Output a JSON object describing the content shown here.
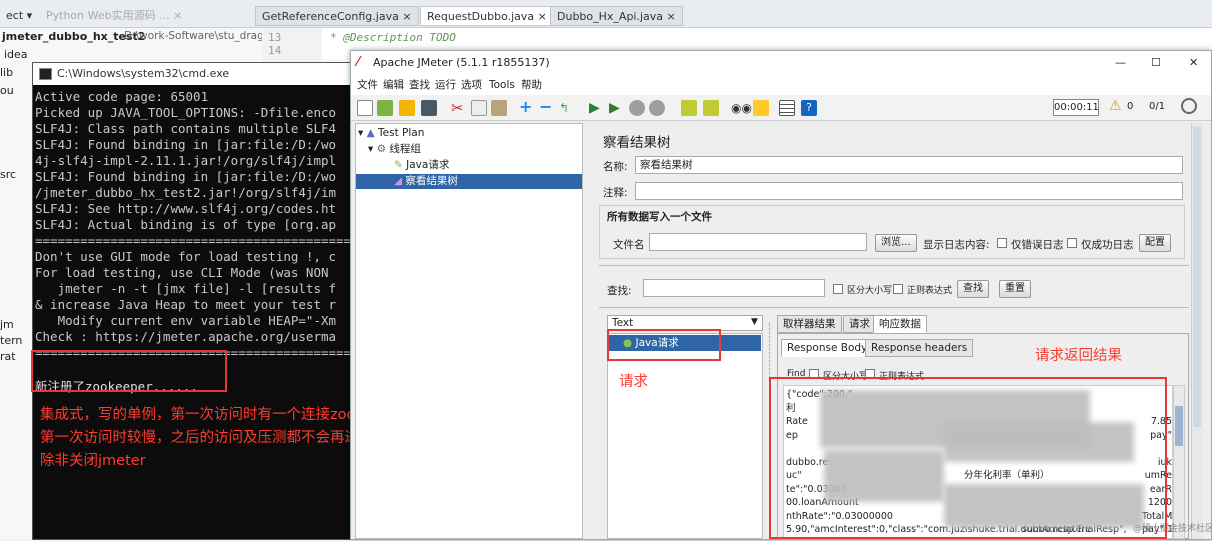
{
  "ide": {
    "tabs": [
      "ect ▾",
      "Python Web实用源码 ... ×",
      "GetReferenceConfig.java ×",
      "RequestDubbo.java ×",
      "Dubbo_Hx_Api.java ×"
    ],
    "project_name": "jmeter_dubbo_hx_test2",
    "project_path": "D:\\work-Software\\stu_draggal",
    "line_numbers": [
      "13",
      "14"
    ],
    "code_line": "* @Description TODO",
    "tree_items": [
      "idea",
      "lib",
      "ou",
      "src",
      "jm",
      "tern",
      "rat"
    ]
  },
  "cmd": {
    "title": "C:\\Windows\\system32\\cmd.exe",
    "lines": [
      "Active code page: 65001",
      "Picked up JAVA_TOOL_OPTIONS: -Dfile.enco",
      "SLF4J: Class path contains multiple SLF4",
      "SLF4J: Found binding in [jar:file:/D:/wo",
      "4j-slf4j-impl-2.11.1.jar!/org/slf4j/impl",
      "SLF4J: Found binding in [jar:file:/D:/wo",
      "/jmeter_dubbo_hx_test2.jar!/org/slf4j/im",
      "SLF4J: See http://www.slf4j.org/codes.ht",
      "SLF4J: Actual binding is of type [org.ap",
      "================================================",
      "Don't use GUI mode for load testing !, c",
      "For load testing, use CLI Mode (was NON",
      "   jmeter -n -t [jmx file] -l [results f",
      "& increase Java Heap to meet your test r",
      "   Modify current env variable HEAP=\"-Xm",
      "Check : https://jmeter.apache.org/userma",
      "================================================",
      "新注册了zookeeper......"
    ]
  },
  "annotations": {
    "left": [
      "集成式，写的单例，第一次访问时有一个连接zookeeper的过程，",
      "第一次访问时较慢，之后的访问及压测都不会再进行连接了，",
      "除非关闭jmeter"
    ],
    "request": "请求",
    "result": "请求返回结果"
  },
  "jmeter": {
    "title": "Apache JMeter (5.1.1 r1855137)",
    "window_controls": [
      "—",
      "☐",
      "✕"
    ],
    "menu": [
      "文件",
      "编辑",
      "查找",
      "运行",
      "选项",
      "Tools",
      "帮助"
    ],
    "timer": "00:00:11",
    "warn_count": "0",
    "threads": "0/1",
    "tree": {
      "test_plan": "Test Plan",
      "thread_group": "线程组",
      "java_request": "Java请求",
      "result_tree": "察看结果树"
    },
    "panel": {
      "title": "察看结果树",
      "name_label": "名称:",
      "name_value": "察看结果树",
      "comment_label": "注释:",
      "write_all_label": "所有数据写入一个文件",
      "filename_label": "文件名",
      "browse_btn": "浏览...",
      "log_content_label": "显示日志内容:",
      "errors_only": "仅错误日志",
      "success_only": "仅成功日志",
      "config_btn": "配置",
      "search_label": "查找:",
      "case_sensitive": "区分大小写",
      "regex": "正则表达式",
      "find_btn": "查找",
      "reset_btn": "重置",
      "renderer": "Text",
      "sample": "Java请求",
      "tabs": [
        "取样器结果",
        "请求",
        "响应数据"
      ],
      "subtabs": [
        "Response Body",
        "Response headers"
      ],
      "find_label": "Find",
      "response_lines": [
        "{\"code\":200,\"",
        "利",
        "Rate",
        "ep",
        "",
        "dubbo.re",
        "uc\"",
        "te\":\"0.03000",
        "00.loanAmount",
        "nthRate\":\"0.03000000",
        "5.90,\"amcInterest\":0,\"class\":\"com.juzishuke.trial.dubbo.resp.TrialResp\","
      ],
      "response_right": [
        "7.85",
        "pay\"",
        "",
        "iuk",
        "umRe",
        "earR",
        "1200",
        "TotalM",
        "pay\":11"
      ],
      "mid_text": "分年化利率（单利）",
      "mid_text2": "sumAmcIntere",
      "watermark": "@稀土掘金技术社区"
    }
  },
  "colors": {
    "accent_red": "#e53935",
    "annotation_red": "#ff3b2f",
    "selection_blue": "#2f65a7"
  }
}
